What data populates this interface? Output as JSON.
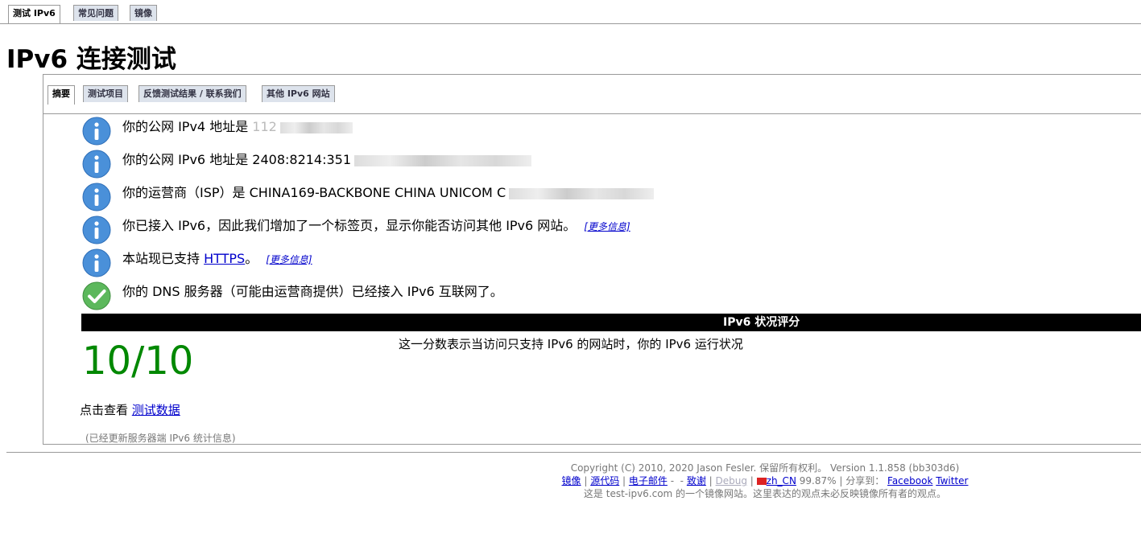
{
  "top_tabs": [
    "测试 IPv6",
    "常见问题",
    "镜像"
  ],
  "page_title": "IPv6 连接测试",
  "sub_tabs": [
    "摘要",
    "测试项目",
    "反馈测试结果 / 联系我们",
    "其他 IPv6 网站"
  ],
  "messages": [
    {
      "icon": "info-icon",
      "text": "你的公网 IPv4 地址是 ",
      "value": "112"
    },
    {
      "icon": "info-icon",
      "text": "你的公网 IPv6 地址是 ",
      "value": "2408:8214:351"
    },
    {
      "icon": "info-icon",
      "text": "你的运营商（ISP）是 ",
      "value": "CHINA169-BACKBONE CHINA UNICOM C"
    },
    {
      "icon": "info-icon",
      "text": "你已接入 IPv6，因此我们增加了一个标签页，显示你能否访问其他 IPv6 网站。",
      "more": "[更多信息]"
    },
    {
      "icon": "info-icon",
      "text": "本站现已支持 ",
      "link": "HTTPS",
      "suffix": "。",
      "more": "[更多信息]"
    },
    {
      "icon": "check-icon",
      "text": "你的 DNS 服务器（可能由运营商提供）已经接入 IPv6 互联网了。"
    }
  ],
  "score_header": "IPv6 状况评分",
  "score": "10/10",
  "score_description": "这一分数表示当访问只支持 IPv6 的网站时，你的 IPv6 运行状况",
  "view_data": {
    "prefix": "点击查看 ",
    "link": "测试数据"
  },
  "stats_note": "(已经更新服务器端 IPv6 统计信息)",
  "footer": {
    "copyright": "Copyright (C) 2010, 2020 Jason Fesler. 保留所有权利。 Version 1.1.858 (bb303d6)",
    "links": {
      "mirror": "镜像",
      "source": "源代码",
      "email": "电子邮件",
      "thanks": "致谢",
      "debug": "Debug",
      "locale": "zh_CN",
      "locale_pct": "99.87%",
      "share_label": "分享到：",
      "facebook": "Facebook",
      "twitter": "Twitter"
    },
    "note": "这是 test-ipv6.com 的一个镜像网站。这里表达的观点未必反映镜像所有者的观点。"
  },
  "colors": {
    "info": "#4a90d9",
    "check": "#5cb85c",
    "score": "#008800",
    "link": "#0000cc"
  }
}
